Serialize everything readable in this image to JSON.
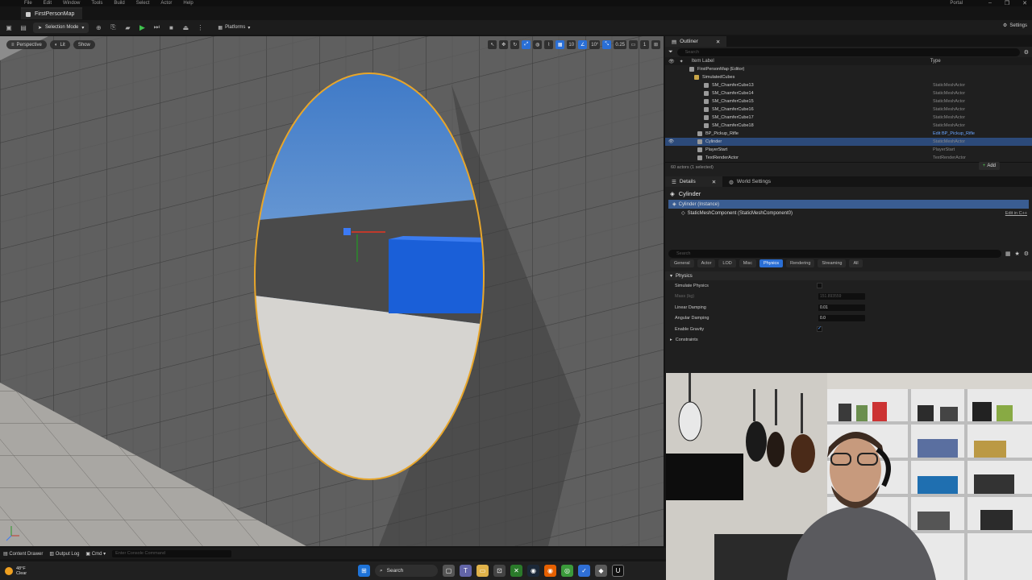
{
  "menu": {
    "items": [
      "File",
      "Edit",
      "Window",
      "Tools",
      "Build",
      "Select",
      "Actor",
      "Help"
    ],
    "right_label": "Portal"
  },
  "window_controls": [
    "–",
    "❐",
    "✕"
  ],
  "document_tab": {
    "label": "FirstPersonMap"
  },
  "toolbar": {
    "mode_label": "Selection Mode",
    "platforms_label": "Platforms",
    "settings_label": "Settings"
  },
  "viewport": {
    "left_pills": [
      "Perspective",
      "Lit",
      "Show"
    ],
    "right_tools": [
      "10",
      "10°",
      "0.25",
      "1"
    ]
  },
  "bottom": {
    "content_drawer": "Content Drawer",
    "output_log": "Output Log",
    "cmd": "Cmd",
    "console_placeholder": "Enter Console Command"
  },
  "outliner": {
    "tab": "Outliner",
    "search_placeholder": "Search",
    "col_label": "Item Label",
    "col_type": "Type",
    "rows": [
      {
        "label": "FirstPersonMap (Editor)",
        "type": "",
        "kind": "map"
      },
      {
        "label": "SimulatedCubes",
        "type": "",
        "kind": "folder"
      },
      {
        "label": "SM_ChamferCube13",
        "type": "StaticMeshActor",
        "kind": "mesh"
      },
      {
        "label": "SM_ChamferCube14",
        "type": "StaticMeshActor",
        "kind": "mesh"
      },
      {
        "label": "SM_ChamferCube15",
        "type": "StaticMeshActor",
        "kind": "mesh"
      },
      {
        "label": "SM_ChamferCube16",
        "type": "StaticMeshActor",
        "kind": "mesh"
      },
      {
        "label": "SM_ChamferCube17",
        "type": "StaticMeshActor",
        "kind": "mesh"
      },
      {
        "label": "SM_ChamferCube18",
        "type": "StaticMeshActor",
        "kind": "mesh"
      },
      {
        "label": "BP_Pickup_Rifle",
        "type": "Edit BP_Pickup_Rifle",
        "kind": "bp"
      },
      {
        "label": "Cylinder",
        "type": "StaticMeshActor",
        "kind": "mesh"
      },
      {
        "label": "PlayerStart",
        "type": "PlayerStart",
        "kind": "actor"
      },
      {
        "label": "TextRenderActor",
        "type": "TextRenderActor",
        "kind": "actor"
      }
    ],
    "selected_index": 9,
    "count": "60 actors (1 selected)"
  },
  "details": {
    "tab": "Details",
    "tab2": "World Settings",
    "title": "Cylinder",
    "add_label": "Add",
    "instance_label": "Cylinder (Instance)",
    "component_label": "StaticMeshComponent (StaticMeshComponent0)",
    "edit_cpp": "Edit in C++",
    "search_placeholder": "Search",
    "categories": [
      "General",
      "Actor",
      "LOD",
      "Misc",
      "Physics",
      "Rendering",
      "Streaming",
      "All"
    ],
    "active_category": "Physics",
    "section": "Physics",
    "props": [
      {
        "label": "Simulate Physics",
        "kind": "check",
        "value": ""
      },
      {
        "label": "Mass (kg)",
        "kind": "num",
        "value": "151.893559",
        "disabled": true
      },
      {
        "label": "Linear Damping",
        "kind": "num",
        "value": "0.01"
      },
      {
        "label": "Angular Damping",
        "kind": "num",
        "value": "0.0"
      },
      {
        "label": "Enable Gravity",
        "kind": "check",
        "value": "✓"
      }
    ],
    "subsection": "Constraints"
  },
  "taskbar": {
    "temp": "48°F",
    "condition": "Clear",
    "search": "Search"
  },
  "colors": {
    "accent": "#2a6fd6",
    "selection": "#2c4a7a",
    "portal_outline": "#e8a62a"
  }
}
